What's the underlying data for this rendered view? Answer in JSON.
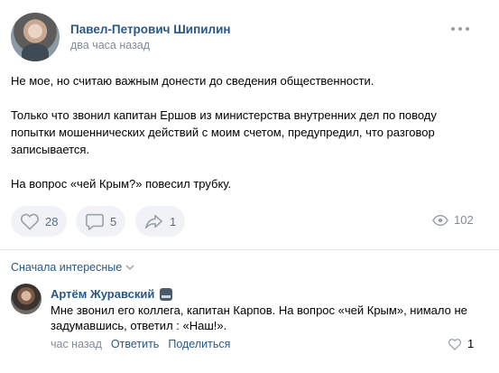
{
  "post": {
    "author": "Павел-Петрович Шипилин",
    "time": "два часа назад",
    "paragraphs": [
      "Не мое, но считаю важным донести до сведения общественности.",
      "Только что звонил капитан Ершов из министерства внутренних дел по поводу попытки мошеннических действий с моим счетом, предупредил, что разговор записывается.",
      "На вопрос «чей Крым?» повесил трубку."
    ],
    "likes": "28",
    "comments": "5",
    "shares": "1",
    "views": "102"
  },
  "comments_section": {
    "sort_label": "Сначала интересные",
    "comment": {
      "author": "Артём Журавский",
      "text": "Мне звонил его коллега, капитан Карпов. На вопрос «чей Крым», нимало не задумавшись, ответил : «Наш!».",
      "time": "час назад",
      "reply_label": "Ответить",
      "share_label": "Поделиться",
      "likes": "1"
    }
  },
  "colors": {
    "link": "#2a5885",
    "muted": "#818c99",
    "button_bg": "#f0f2f5",
    "icon": "#5e6e80"
  }
}
